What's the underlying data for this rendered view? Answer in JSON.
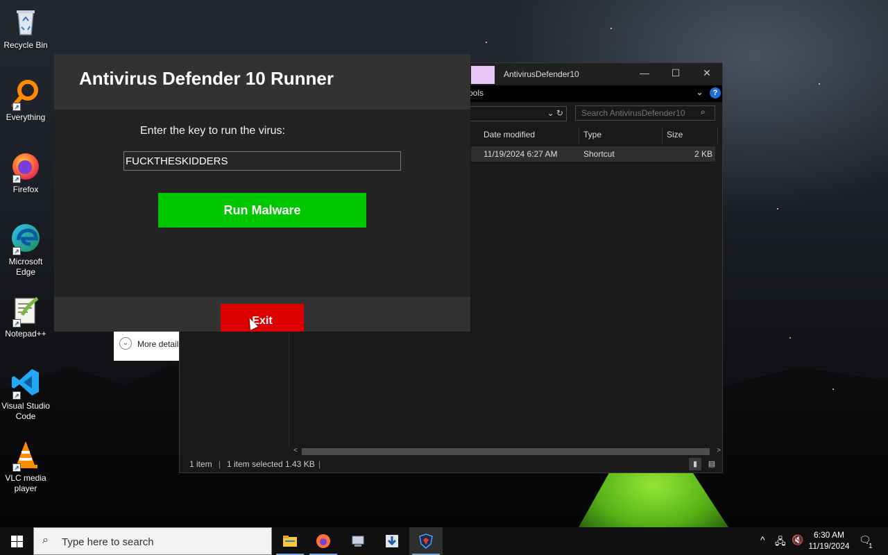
{
  "desktop": {
    "icons": [
      {
        "label": "Recycle Bin"
      },
      {
        "label": "Everything"
      },
      {
        "label": "Firefox"
      },
      {
        "label": "Microsoft Edge"
      },
      {
        "label": "Notepad++"
      },
      {
        "label": "Visual Studio Code"
      },
      {
        "label": "VLC media player"
      }
    ]
  },
  "explorer": {
    "title": "AntivirusDefender10",
    "ribbon_tools": "ools",
    "help_glyph": "?",
    "search_placeholder": "Search AntivirusDefender10",
    "columns": [
      "Date modified",
      "Type",
      "Size"
    ],
    "file": {
      "date": "11/19/2024 6:27 AM",
      "type": "Shortcut",
      "size": "2 KB"
    },
    "status": {
      "count": "1 item",
      "selected": "1 item selected",
      "size": "1.43 KB"
    }
  },
  "more_details": {
    "label": "More details"
  },
  "runner": {
    "title": "Antivirus Defender 10 Runner",
    "prompt": "Enter the key to run the virus:",
    "key_value": "FUCKTHESKIDDERS",
    "run_label": "Run Malware",
    "exit_label": "Exit"
  },
  "taskbar": {
    "search_placeholder": "Type here to search",
    "apps": [
      "file-explorer",
      "firefox",
      "computer",
      "downloads",
      "antivirus-defender"
    ],
    "time": "6:30 AM",
    "date": "11/19/2024",
    "notification_count": "1"
  }
}
